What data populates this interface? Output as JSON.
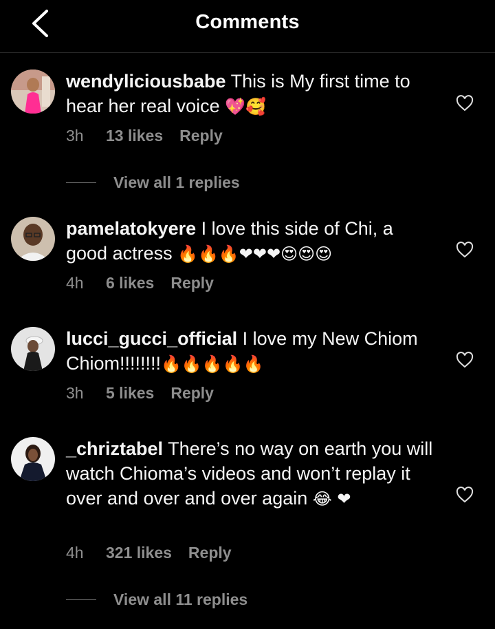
{
  "header": {
    "title": "Comments"
  },
  "comments": [
    {
      "username": "wendyliciousbabe",
      "text": " This is My first time to hear her real voice ",
      "emojis": "💖🥰",
      "time": "3h",
      "likes": "13 likes",
      "reply": "Reply",
      "view_replies": "View all 1 replies"
    },
    {
      "username": "pamelatokyere",
      "text": " I love this side of Chi, a good actress ",
      "emojis": "🔥🔥🔥❤❤❤😍😍😍",
      "time": "4h",
      "likes": "6 likes",
      "reply": "Reply"
    },
    {
      "username": "lucci_gucci_official",
      "text": " I love my New Chiom Chiom!!!!!!!!",
      "emojis": "🔥🔥🔥🔥🔥",
      "time": "3h",
      "likes": "5 likes",
      "reply": "Reply"
    },
    {
      "username": "_chriztabel",
      "text": " There’s no way on earth you will watch Chioma’s videos and won’t replay it over and over and over again ",
      "emojis": "😂 ❤",
      "time": "4h",
      "likes": "321 likes",
      "reply": "Reply",
      "view_replies": "View all 11 replies"
    }
  ],
  "colors": {
    "background": "#000000",
    "text": "#ffffff",
    "muted": "#8e8e8e",
    "heart": "#ff3040",
    "fire": "#ff7a00"
  }
}
